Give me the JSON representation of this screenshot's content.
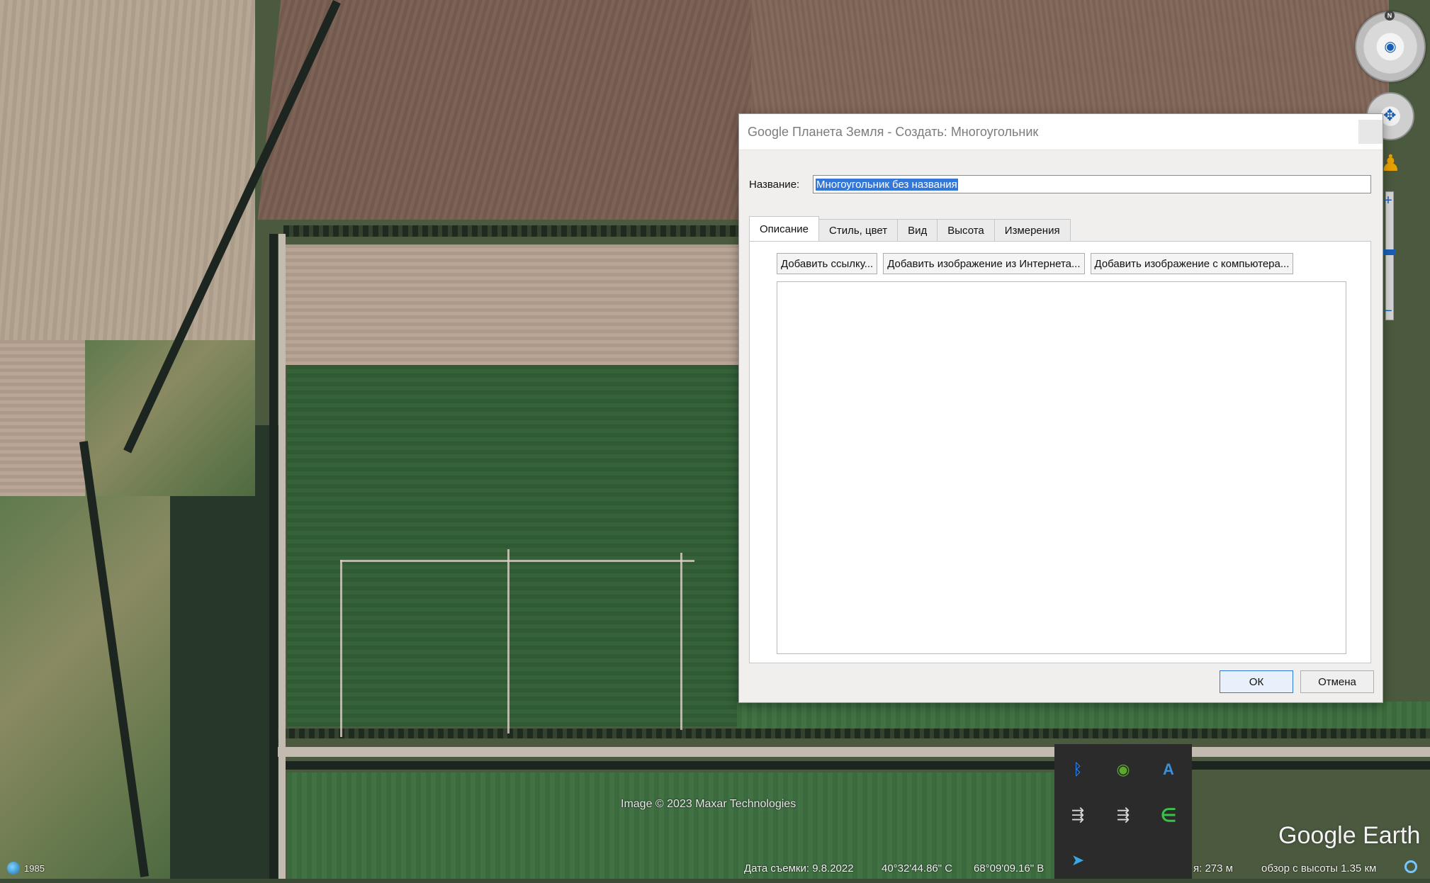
{
  "dialog": {
    "title": "Google Планета Земля - Создать: Многоугольник",
    "name_label": "Название:",
    "name_value": "Многоугольник без названия",
    "tabs": [
      {
        "label": "Описание"
      },
      {
        "label": "Стиль, цвет"
      },
      {
        "label": "Вид"
      },
      {
        "label": "Высота"
      },
      {
        "label": "Измерения"
      }
    ],
    "buttons": {
      "add_link": "Добавить ссылку...",
      "add_web_image": "Добавить изображение из Интернета...",
      "add_local_image": "Добавить изображение с компьютера..."
    },
    "ok": "ОК",
    "cancel": "Отмена"
  },
  "map": {
    "credit": "Image © 2023 Maxar Technologies",
    "logo": "Google Earth",
    "compass_north": "N"
  },
  "status": {
    "year": "1985",
    "capture_date": "Дата съемки: 9.8.2022",
    "lat": "40°32'44.86\" С",
    "lon": "68°09'09.16\" В",
    "elevation": "я:  273 м",
    "eye_alt": "обзор с высоты   1.35 км"
  },
  "tray": {
    "icons": [
      "bluetooth-icon",
      "nvidia-icon",
      "autodesk-icon",
      "sync-icon",
      "sync-icon",
      "green-e-icon",
      "telegram-icon"
    ]
  },
  "colors": {
    "selection": "#3377d9",
    "accent": "#1a5fb4"
  }
}
